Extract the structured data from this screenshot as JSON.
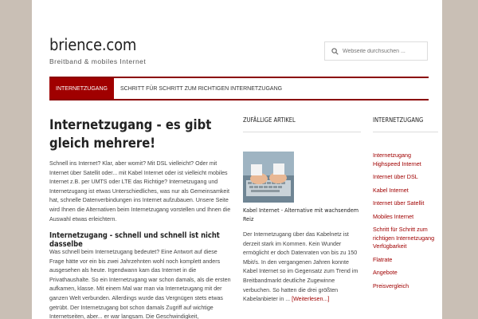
{
  "site": {
    "title": "briencе.com",
    "description": "Breitband & mobiles Internet"
  },
  "search": {
    "placeholder": "Webseite durchsuchen ..."
  },
  "nav": {
    "items": [
      {
        "label": "Internetzugang"
      },
      {
        "label": "Schritt für Schritt zum richtigen Internetzugang"
      }
    ]
  },
  "main": {
    "title": "Internetzugang - es gibt gleich mehrere!",
    "paragraph1": "Schnell ins Internet? Klar, aber womit? Mit DSL vielleicht? Oder mit Internet über Satellit oder... mit Kabel Internet oder ist vielleicht mobiles Internet z.B. per UMTS oder LTE das Richtige? Internetzugang und Internetzugang ist etwas Unterschiedliches, was nur als Gemeinsamkeit hat, schnelle Datenverbindungen ins Internet aufzubauen. Unsere Seite wird Ihnen die Alternativen beim Internetzugang vorstellen und Ihnen die Auswahl etwas erleichtern.",
    "heading2": "Internetzugang - schnell und schnell ist nicht dasselbe",
    "paragraph2": "Was schnell beim Internetzugang bedeutet? Eine Antwort auf diese Frage hätte vor ein bis zwei Jahrzehnten wohl noch komplett anders ausgesehen als heute. Irgendwann kam das Internet in die Privathaushalte. So ein Internetzugang war schon damals, als die ersten aufkamen, klasse. Mit einem Mal war man via Internetzugang mit der ganzen Welt verbunden. Allerdings wurde das Vergnügen stets etwas getrübt. Der Internetzugang bot schon damals Zugriff auf wichtige Internetseiten, aber... er war langsam. Die Geschwindigkeit,"
  },
  "random_articles": {
    "title": "Zufällige Artikel",
    "article_title": "Kabel Internet - Alternative mit wachsendem Reiz",
    "article_text": "Der Internetzugang über das Kabelnetz ist derzeit stark im Kommen. Kein Wunder ermöglicht er doch Datenraten von bis zu 150 Mbit/s. In den vergangenen Jahren konnte Kabel Internet so im Gegensatz zum Trend im Breitbandmarkt deutliche Zugewinne verbuchen. So hatten die drei größten Kabelanbieter in ...",
    "more_link": "[Weiterlesen...]"
  },
  "sidebar": {
    "title": "Internetzugang",
    "items": [
      {
        "label": "Internetzugang Highspeed Internet"
      },
      {
        "label": "Internet über DSL"
      },
      {
        "label": "Kabel Internet"
      },
      {
        "label": "Internet über Satellit"
      },
      {
        "label": "Mobiles Internet"
      },
      {
        "label": "Schritt für Schritt zum richtigen Internetzugang Verfügbarkeit"
      },
      {
        "label": "Flatrate"
      },
      {
        "label": "Angebote"
      },
      {
        "label": "Preisvergleich"
      }
    ]
  },
  "colors": {
    "accent": "#a00000",
    "background": "#c9bfb5"
  }
}
